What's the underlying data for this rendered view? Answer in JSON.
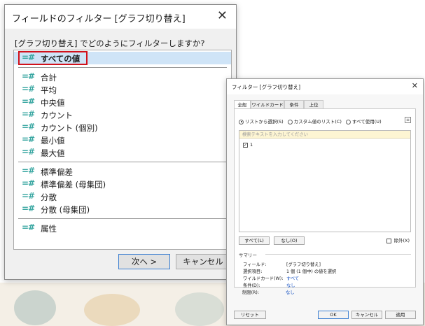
{
  "dialog1": {
    "title": "フィールドのフィルター [グラフ切り替え]",
    "question": "[グラフ切り替え] でどのようにフィルターしますか?",
    "groups": [
      [
        "すべての値"
      ],
      [
        "合計",
        "平均",
        "中央値",
        "カウント",
        "カウント (個別)",
        "最小値",
        "最大値"
      ],
      [
        "標準偏差",
        "標準偏差 (母集団)",
        "分散",
        "分散 (母集団)"
      ],
      [
        "属性"
      ]
    ],
    "selected_label": "すべての値",
    "next_button": "次へ >",
    "cancel_button": "キャンセル"
  },
  "dialog2": {
    "title": "フィルター [グラフ切り替え]",
    "tabs": [
      "全般",
      "ワイルドカード",
      "条件",
      "上位"
    ],
    "active_tab": "全般",
    "radios": [
      "リストから選択(S)",
      "カスタム値のリスト(C)",
      "すべて使用(U)"
    ],
    "selected_radio": "リストから選択(S)",
    "search_placeholder": "検索テキストを入力してください",
    "items": [
      {
        "label": "1",
        "checked": true
      }
    ],
    "all_button": "すべて(L)",
    "none_button": "なし(O)",
    "exclude_label": "除外(X)",
    "summary": {
      "title": "サマリー",
      "rows": [
        {
          "key": "フィールド:",
          "value": "[グラフ切り替え]",
          "link": false
        },
        {
          "key": "選択項目:",
          "value": "1 個 (1 個中) の値を選択",
          "link": false
        },
        {
          "key": "ワイルドカード(W):",
          "value": "すべて",
          "link": true
        },
        {
          "key": "条件(D):",
          "value": "なし",
          "link": true
        },
        {
          "key": "制限(R):",
          "value": "なし",
          "link": true
        }
      ]
    },
    "reset_button": "リセット",
    "ok_button": "OK",
    "cancel_button": "キャンセル",
    "apply_button": "適用"
  }
}
